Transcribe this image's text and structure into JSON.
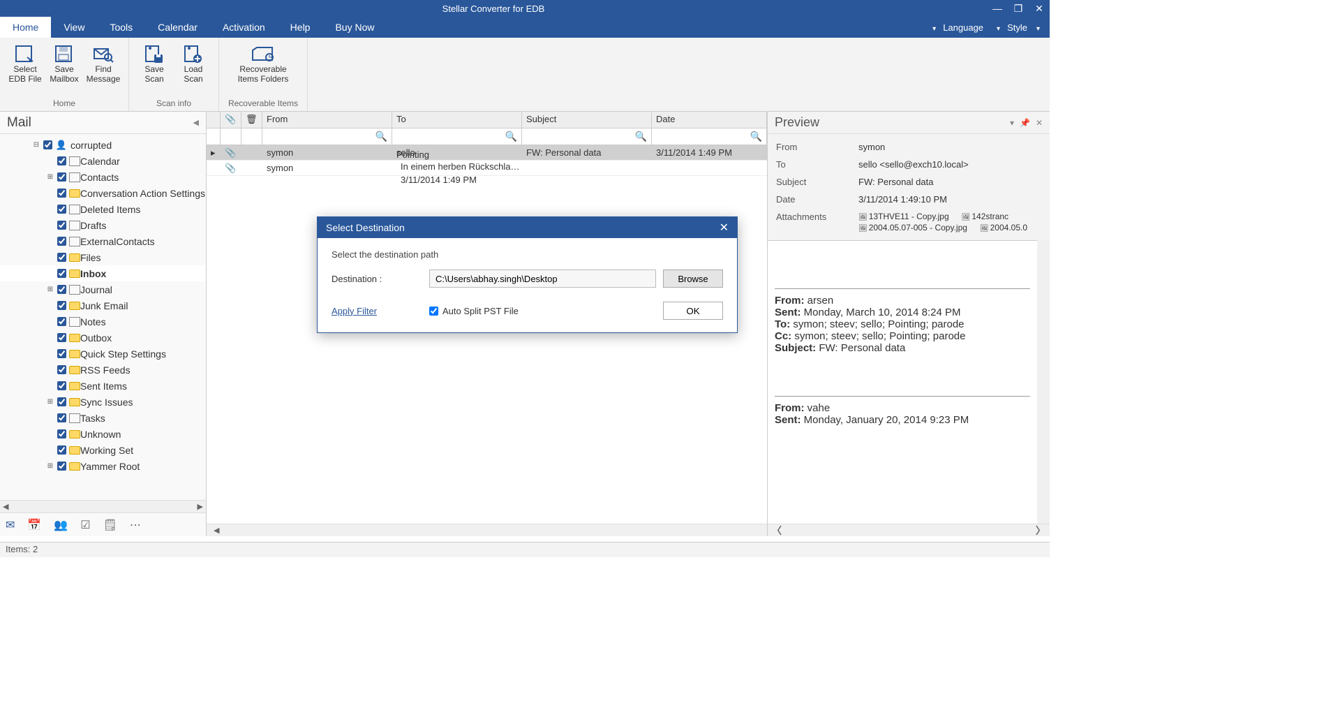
{
  "titlebar": {
    "title": "Stellar Converter for EDB"
  },
  "menutabs": {
    "tabs": [
      "Home",
      "View",
      "Tools",
      "Calendar",
      "Activation",
      "Help",
      "Buy Now"
    ],
    "active": 0,
    "language": "Language",
    "style": "Style"
  },
  "ribbon": {
    "groups": [
      {
        "label": "Home",
        "buttons": [
          {
            "name": "select-edb-file",
            "line1": "Select",
            "line2": "EDB File"
          },
          {
            "name": "save-mailbox",
            "line1": "Save",
            "line2": "Mailbox"
          },
          {
            "name": "find-message",
            "line1": "Find",
            "line2": "Message"
          }
        ]
      },
      {
        "label": "Scan info",
        "buttons": [
          {
            "name": "save-scan",
            "line1": "Save",
            "line2": "Scan"
          },
          {
            "name": "load-scan",
            "line1": "Load",
            "line2": "Scan"
          }
        ]
      },
      {
        "label": "Recoverable Items",
        "buttons": [
          {
            "name": "recoverable-items-folders",
            "line1": "Recoverable",
            "line2": "Items Folders"
          }
        ]
      }
    ]
  },
  "sidebar": {
    "title": "Mail",
    "root": "corrupted",
    "items": [
      {
        "label": "Calendar",
        "icon": "calendar",
        "expand": ""
      },
      {
        "label": "Contacts",
        "icon": "contacts",
        "expand": "+"
      },
      {
        "label": "Conversation Action Settings",
        "icon": "folder",
        "expand": ""
      },
      {
        "label": "Deleted Items",
        "icon": "trash",
        "expand": ""
      },
      {
        "label": "Drafts",
        "icon": "drafts",
        "expand": ""
      },
      {
        "label": "ExternalContacts",
        "icon": "contacts",
        "expand": ""
      },
      {
        "label": "Files",
        "icon": "folder",
        "expand": ""
      },
      {
        "label": "Inbox",
        "icon": "folder",
        "expand": "",
        "selected": true
      },
      {
        "label": "Journal",
        "icon": "journal",
        "expand": "+"
      },
      {
        "label": "Junk Email",
        "icon": "folder",
        "expand": ""
      },
      {
        "label": "Notes",
        "icon": "notes",
        "expand": ""
      },
      {
        "label": "Outbox",
        "icon": "folder",
        "expand": ""
      },
      {
        "label": "Quick Step Settings",
        "icon": "folder",
        "expand": ""
      },
      {
        "label": "RSS Feeds",
        "icon": "folder",
        "expand": ""
      },
      {
        "label": "Sent Items",
        "icon": "folder",
        "expand": ""
      },
      {
        "label": "Sync Issues",
        "icon": "folder",
        "expand": "+"
      },
      {
        "label": "Tasks",
        "icon": "tasks",
        "expand": ""
      },
      {
        "label": "Unknown",
        "icon": "folder",
        "expand": ""
      },
      {
        "label": "Working Set",
        "icon": "folder",
        "expand": ""
      },
      {
        "label": "Yammer Root",
        "icon": "folder",
        "expand": "+"
      }
    ]
  },
  "msglist": {
    "headers": {
      "from": "From",
      "to": "To",
      "subject": "Subject",
      "date": "Date"
    },
    "rows": [
      {
        "from": "symon",
        "to": "sello <sello@exch10.local>",
        "subject": "FW: Personal data",
        "date": "3/11/2014 1:49 PM",
        "selected": true,
        "attach": true
      },
      {
        "from": "symon",
        "to": "Pointing <Pointing@exch10.lo...",
        "subject": "In einem herben Rückschlag f...",
        "date": "3/11/2014 1:49 PM",
        "selected": false,
        "attach": true
      }
    ]
  },
  "preview": {
    "title": "Preview",
    "from_label": "From",
    "from": "symon",
    "to_label": "To",
    "to": "sello <sello@exch10.local>",
    "subject_label": "Subject",
    "subject": "FW: Personal data",
    "date_label": "Date",
    "date": "3/11/2014 1:49:10 PM",
    "attachments_label": "Attachments",
    "attachments": [
      "13THVE11 - Copy.jpg",
      "142stranc",
      "2004.05.07-005 - Copy.jpg",
      "2004.05.0"
    ],
    "body": {
      "block1": {
        "from": "arsen",
        "sent": "Monday, March 10, 2014 8:24 PM",
        "to": "symon; steev; sello; Pointing; parode",
        "cc": "symon; steev; sello; Pointing; parode",
        "subject": "FW: Personal data"
      },
      "block2": {
        "from": "vahe",
        "sent": "Monday, January 20, 2014 9:23 PM"
      }
    }
  },
  "dialog": {
    "title": "Select Destination",
    "instruction": "Select the destination path",
    "dest_label": "Destination :",
    "dest_value": "C:\\Users\\abhay.singh\\Desktop",
    "browse": "Browse",
    "apply_filter": "Apply Filter",
    "autosplit": "Auto Split PST File",
    "ok": "OK"
  },
  "statusbar": {
    "items": "Items: 2"
  }
}
